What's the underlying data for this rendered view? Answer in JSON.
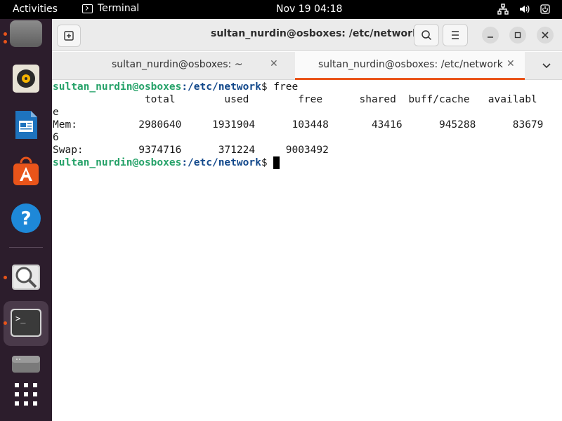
{
  "topbar": {
    "activities": "Activities",
    "app_name": "Terminal",
    "clock": "Nov 19  04:18"
  },
  "window": {
    "title": "sultan_nurdin@osboxes: /etc/network",
    "tabs": [
      {
        "label": "sultan_nurdin@osboxes: ~",
        "active": false
      },
      {
        "label": "sultan_nurdin@osboxes: /etc/network",
        "active": true
      }
    ]
  },
  "terminal": {
    "prompt_user": "sultan_nurdin@osboxes",
    "prompt_path": ":/etc/network",
    "prompt_symbol": "$ ",
    "command": "free",
    "output_lines": [
      "               total        used        free      shared  buff/cache   availabl",
      "e",
      "Mem:          2980640     1931904      103448       43416      945288      83679",
      "6",
      "Swap:         9374716      371224     9003492"
    ]
  },
  "colors": {
    "accent": "#e9541a",
    "dock": "#2c1d2c",
    "prompt_user": "#26a269",
    "prompt_path": "#12488b"
  },
  "dock_icons": [
    "files-icon",
    "rhythmbox-icon",
    "writer-icon",
    "app-center-icon",
    "help-icon",
    "image-viewer-icon",
    "terminal-icon",
    "disk-icon",
    "show-apps-icon"
  ]
}
